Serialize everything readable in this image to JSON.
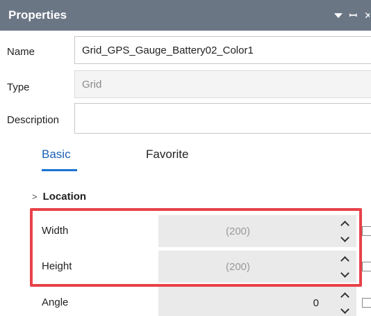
{
  "panel": {
    "title": "Properties"
  },
  "fields": {
    "name_label": "Name",
    "name_value": "Grid_GPS_Gauge_Battery02_Color1",
    "type_label": "Type",
    "type_value": "Grid",
    "description_label": "Description",
    "description_value": ""
  },
  "tabs": {
    "basic": "Basic",
    "favorite": "Favorite",
    "active": "Basic"
  },
  "section": {
    "label": "Location"
  },
  "properties": [
    {
      "label": "Width",
      "value": "(200)",
      "readonly": true
    },
    {
      "label": "Height",
      "value": "(200)",
      "readonly": true
    },
    {
      "label": "Angle",
      "value": "0",
      "readonly": false
    }
  ],
  "colors": {
    "titlebar": "#6b7685",
    "accent": "#1a73d1",
    "highlight": "#e8424a"
  },
  "icons": {
    "dropdown": "dropdown-icon",
    "pin": "pin-icon",
    "close": "close-icon",
    "expand": "chevron-right-icon",
    "spin_up": "spin-up-icon",
    "spin_down": "spin-down-icon"
  }
}
